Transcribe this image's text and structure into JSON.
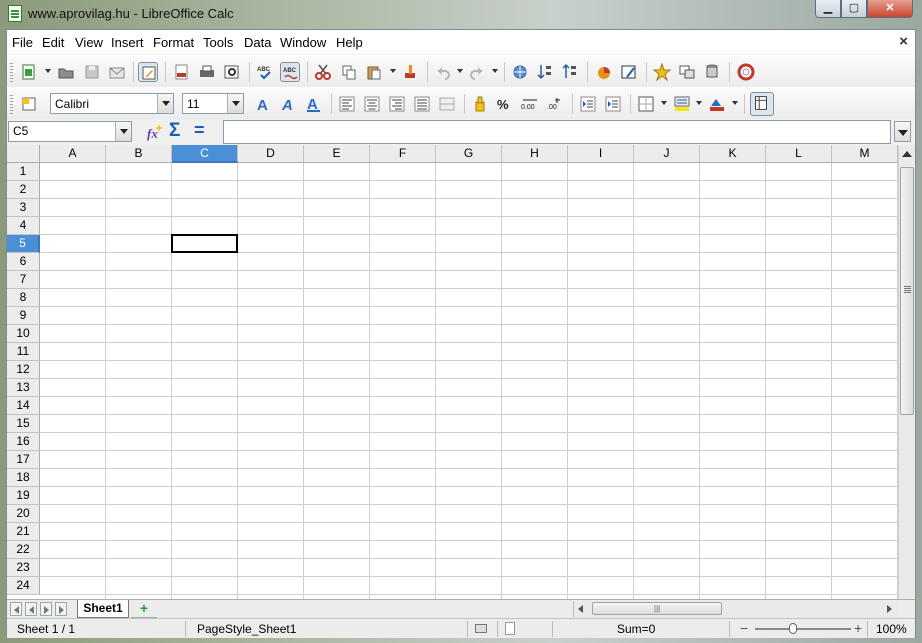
{
  "window": {
    "title": "www.aprovilag.hu  - LibreOffice Calc",
    "minimize_glyph": "▁",
    "maximize_glyph": "▢",
    "close_glyph": "✕"
  },
  "menubar": {
    "items": [
      {
        "label": "File",
        "id": "file"
      },
      {
        "label": "Edit",
        "id": "edit"
      },
      {
        "label": "View",
        "id": "view"
      },
      {
        "label": "Insert",
        "id": "insert"
      },
      {
        "label": "Format",
        "id": "format"
      },
      {
        "label": "Tools",
        "id": "tools"
      },
      {
        "label": "Data",
        "id": "data"
      },
      {
        "label": "Window",
        "id": "window"
      },
      {
        "label": "Help",
        "id": "help"
      }
    ],
    "close_doc_glyph": "×"
  },
  "formatting": {
    "font_name": "Calibri",
    "font_size": "11"
  },
  "formula_bar": {
    "name_box": "C5",
    "sum_glyph": "Σ",
    "equals_glyph": "=",
    "input_value": ""
  },
  "grid": {
    "columns": [
      "A",
      "B",
      "C",
      "D",
      "E",
      "F",
      "G",
      "H",
      "I",
      "J",
      "K",
      "L",
      "M"
    ],
    "rows": [
      "1",
      "2",
      "3",
      "4",
      "5",
      "6",
      "7",
      "8",
      "9",
      "10",
      "11",
      "12",
      "13",
      "14",
      "15",
      "16",
      "17",
      "18",
      "19",
      "20",
      "21",
      "22",
      "23",
      "24"
    ],
    "selected_column": "C",
    "selected_row": "5"
  },
  "sheets": {
    "tabs": [
      {
        "label": "Sheet1",
        "active": true
      }
    ],
    "add_glyph": "+",
    "hscroll_grip": "|||"
  },
  "statusbar": {
    "sheet_position": "Sheet 1 / 1",
    "page_style": "PageStyle_Sheet1",
    "sum": "Sum=0",
    "zoom_minus": "−",
    "zoom_plus": "+",
    "zoom": "100%"
  },
  "colors": {
    "selection_accent": "#4b8fd8",
    "link_blue": "#1b5cb5"
  }
}
